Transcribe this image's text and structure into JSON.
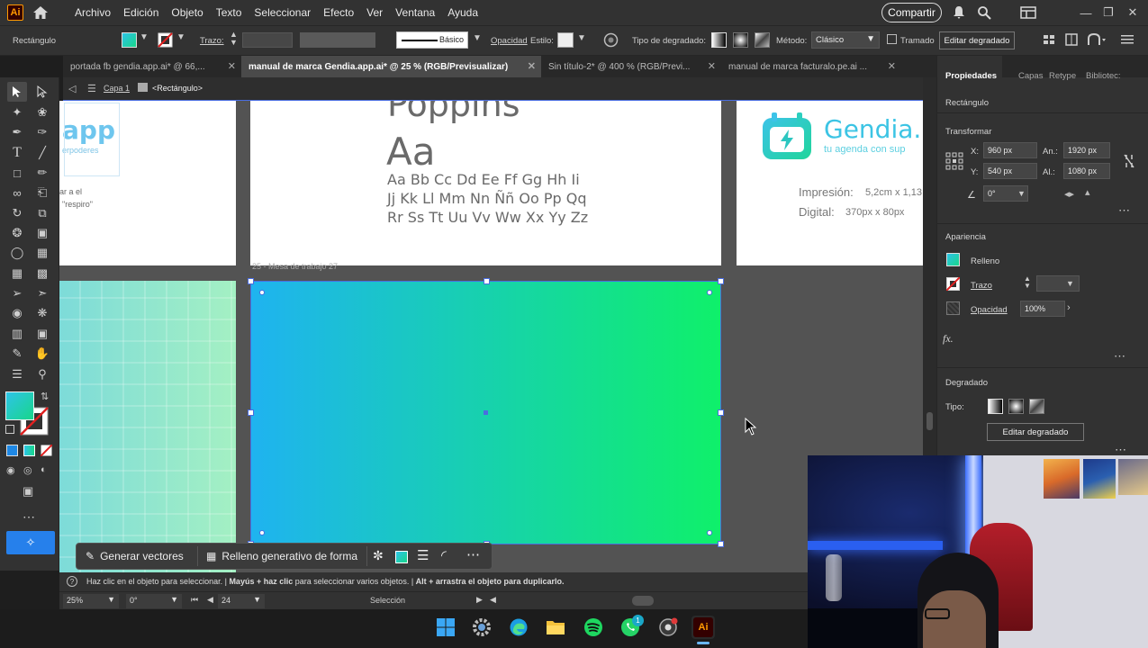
{
  "app": {
    "logo": "Ai",
    "menu": [
      "Archivo",
      "Edición",
      "Objeto",
      "Texto",
      "Seleccionar",
      "Efecto",
      "Ver",
      "Ventana",
      "Ayuda"
    ],
    "share_label": "Compartir"
  },
  "control_bar": {
    "object_type": "Rectángulo",
    "stroke_label": "Trazo:",
    "stroke_profile": "Básico",
    "opacity_label": "Opacidad",
    "style_label": "Estilo:",
    "gradient_type_label": "Tipo de degradado:",
    "method_label": "Método:",
    "method_value": "Clásico",
    "dither_label": "Tramado",
    "edit_gradient_label": "Editar degradado"
  },
  "tabs": [
    {
      "label": "portada fb gendia.app.ai* @ 66,..."
    },
    {
      "label": "manual de marca Gendia.app.ai* @ 25 % (RGB/Previsualizar)",
      "active": true
    },
    {
      "label": "Sin título-2* @ 400 % (RGB/Previ..."
    },
    {
      "label": "manual de marca facturalo.pe.ai ..."
    }
  ],
  "breadcrumb": {
    "layer": "Capa 1",
    "object": "<Rectángulo>"
  },
  "canvas": {
    "left_partial_text": [
      "app",
      "erpoderes",
      "ar a el",
      "\"respiro\""
    ],
    "font_name": "Poppins",
    "font_sample_big": "Aa",
    "font_sample_lines": [
      "Aa Bb Cc Dd Ee Ff Gg Hh Ii",
      "Jj Kk Ll Mm Nn Ññ Oo Pp Qq",
      "Rr Ss Tt Uu Vv Ww Xx Yy Zz"
    ],
    "brand_name": "Gendia.",
    "brand_tagline": "tu agenda con sup",
    "print_label": "Impresión:",
    "print_value": "5,2cm x 1,13",
    "digital_label": "Digital:",
    "digital_value": "370px x 80px",
    "artboard_label": "25 - Mesa de trabajo 27",
    "gradient_colors": {
      "start": "#1fb3f0",
      "end": "#0ff06a"
    }
  },
  "context_taskbar": {
    "generate_vectors": "Generar vectores",
    "generative_fill": "Relleno generativo de forma"
  },
  "properties_panel": {
    "tabs": [
      "Propiedades",
      "Capas",
      "Retype",
      "Bibliotec:"
    ],
    "object_type": "Rectángulo",
    "transform_title": "Transformar",
    "x_label": "X:",
    "x_value": "960 px",
    "y_label": "Y:",
    "y_value": "540 px",
    "w_label": "An.:",
    "w_value": "1920 px",
    "h_label": "Al.:",
    "h_value": "1080 px",
    "angle_value": "0°",
    "appearance_title": "Apariencia",
    "fill_label": "Relleno",
    "stroke_label": "Trazo",
    "opacity_label": "Opacidad",
    "opacity_value": "100%",
    "fx_label": "fx.",
    "gradient_title": "Degradado",
    "type_label": "Tipo:",
    "edit_gradient_button": "Editar degradado"
  },
  "status": {
    "hint_1": "Haz clic en el objeto para seleccionar.",
    "hint_2": "Mayús + haz clic",
    "hint_3": "para seleccionar varios objetos.",
    "hint_4": "Alt + arrastra el objeto para duplicarlo.",
    "zoom": "25%",
    "rotation": "0°",
    "artboard_number": "24",
    "tool_name": "Selección"
  },
  "windows_taskbar": {
    "whatsapp_badge": "1",
    "illustrator_label": "Ai"
  }
}
